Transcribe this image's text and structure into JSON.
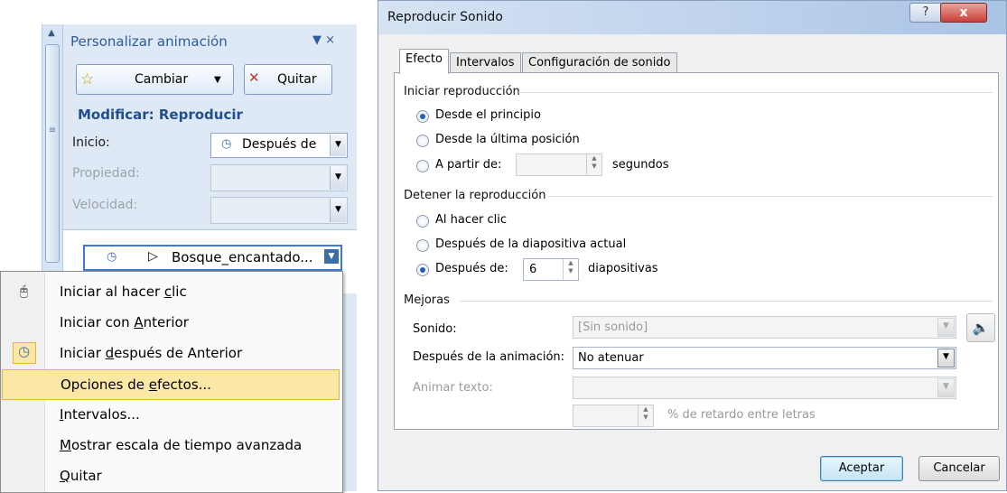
{
  "task_pane": {
    "title": "Personalizar animación",
    "change_button": "Cambiar",
    "remove_button": "Quitar",
    "section_title": "Modificar: Reproducir",
    "start_label": "Inicio:",
    "start_value": "Después de",
    "property_label": "Propiedad:",
    "speed_label": "Velocidad:",
    "list_item": "Bosque_encantado...",
    "list_item_icon": "clock-icon"
  },
  "context_menu": {
    "items": [
      {
        "pre": "Iniciar al hacer ",
        "key": "c",
        "post": "lic",
        "icon": "mouse-icon"
      },
      {
        "pre": "Iniciar con ",
        "key": "A",
        "post": "nterior",
        "icon": ""
      },
      {
        "pre": "Iniciar ",
        "key": "d",
        "post": "espués de Anterior",
        "icon": "clock-icon"
      },
      {
        "pre": "Opciones de ",
        "key": "e",
        "post": "fectos...",
        "icon": ""
      },
      {
        "pre": "",
        "key": "I",
        "post": "ntervalos...",
        "icon": ""
      },
      {
        "pre": "",
        "key": "M",
        "post": "ostrar escala de tiempo avanzada",
        "icon": ""
      },
      {
        "pre": "",
        "key": "Q",
        "post": "uitar",
        "icon": ""
      }
    ],
    "highlight_color": "#fce8a6"
  },
  "dialog": {
    "title": "Reproducir Sonido",
    "help_button": "?",
    "close_button": "x",
    "tabs": [
      "Efecto",
      "Intervalos",
      "Configuración de sonido"
    ],
    "start_group": "Iniciar reproducción",
    "start_options": [
      "Desde el principio",
      "Desde la última posición",
      "A partir de:"
    ],
    "start_seconds_unit": "segundos",
    "stop_group": "Detener la reproducción",
    "stop_options": [
      "Al hacer clic",
      "Después de la diapositiva actual",
      "Después de:"
    ],
    "stop_after_value": "6",
    "stop_after_unit": "diapositivas",
    "enh_group": "Mejoras",
    "sound_label": "Sonido:",
    "sound_value": "[Sin sonido]",
    "after_anim_label": "Después de la animación:",
    "after_anim_value": "No atenuar",
    "animate_text_label": "Animar texto:",
    "delay_label": "% de retardo entre letras",
    "ok_button": "Aceptar",
    "cancel_button": "Cancelar"
  }
}
